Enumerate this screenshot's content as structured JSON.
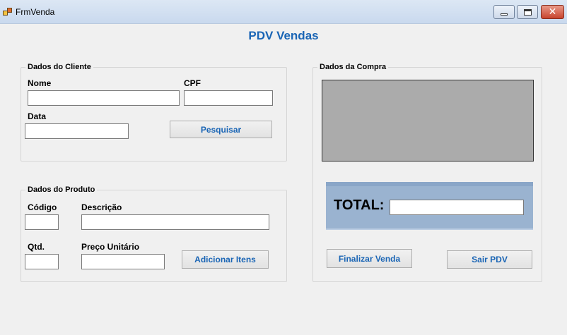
{
  "window": {
    "title": "FrmVenda"
  },
  "form": {
    "heading": "PDV Vendas"
  },
  "cliente": {
    "group_title": "Dados do Cliente",
    "nome_label": "Nome",
    "nome_value": "",
    "cpf_label": "CPF",
    "cpf_value": "",
    "data_label": "Data",
    "data_value": "",
    "pesquisar_label": "Pesquisar"
  },
  "produto": {
    "group_title": "Dados do Produto",
    "codigo_label": "Código",
    "codigo_value": "",
    "descricao_label": "Descrição",
    "descricao_value": "",
    "qtd_label": "Qtd.",
    "qtd_value": "",
    "preco_label": "Preço Unitário",
    "preco_value": "",
    "adicionar_label": "Adicionar Itens"
  },
  "compra": {
    "group_title": "Dados da Compra",
    "total_label": "TOTAL:",
    "total_value": "",
    "finalizar_label": "Finalizar Venda",
    "sair_label": "Sair PDV"
  },
  "colors": {
    "accent": "#1a65b5",
    "grid": "#ababab",
    "total_panel": "#9ab3d0"
  }
}
